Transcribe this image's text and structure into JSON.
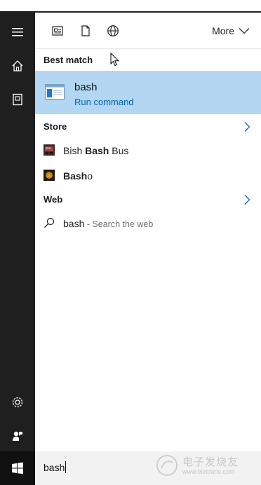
{
  "topbar": {
    "more_label": "More"
  },
  "sections": {
    "best_match": "Best match",
    "store": "Store",
    "web": "Web"
  },
  "best_match": {
    "title": "bash",
    "subtitle": "Run command"
  },
  "store_items": [
    {
      "prefix": "Bish ",
      "bold": "Bash",
      "suffix": " Bus"
    },
    {
      "prefix": "",
      "bold": "Bash",
      "suffix": "o"
    }
  ],
  "web_item": {
    "query": "bash",
    "hint": " - Search the web"
  },
  "search": {
    "value": "bash"
  },
  "watermark": {
    "line1": "电子发烧友",
    "line2": "www.elecfans.com"
  },
  "colors": {
    "sidebar": "#1f1f1f",
    "selection": "#b3d7f2",
    "accent_link": "#0063b1"
  },
  "icons": {
    "sidebar": [
      "hamburger-icon",
      "home-icon",
      "notebook-icon",
      "settings-icon",
      "feedback-icon",
      "windows-start-icon"
    ],
    "filters": [
      "apps-filter-icon",
      "documents-filter-icon",
      "web-filter-icon"
    ]
  }
}
